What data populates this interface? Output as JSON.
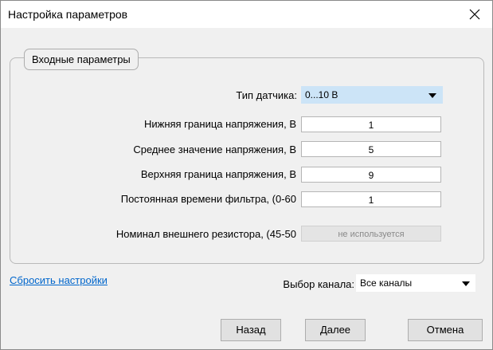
{
  "window": {
    "title": "Настройка параметров"
  },
  "group": {
    "legend": "Входные параметры"
  },
  "sensor_type": {
    "label": "Тип датчика:",
    "value": "0...10 В"
  },
  "params": [
    {
      "label": "Нижняя граница напряжения, В",
      "value": "1"
    },
    {
      "label": "Среднее значение напряжения, В",
      "value": "5"
    },
    {
      "label": "Верхняя граница напряжения, В",
      "value": "9"
    },
    {
      "label": "Постоянная времени фильтра, (0-60",
      "value": "1"
    },
    {
      "label": "Номинал внешнего резистора, (45-50",
      "value": "не используется"
    }
  ],
  "reset_link": "Сбросить настройки",
  "channel": {
    "label": "Выбор канала:",
    "value": "Все каналы"
  },
  "buttons": {
    "back": "Назад",
    "next": "Далее",
    "cancel": "Отмена"
  },
  "colors": {
    "selected_bg": "#cce4f7",
    "link": "#0066cc"
  }
}
